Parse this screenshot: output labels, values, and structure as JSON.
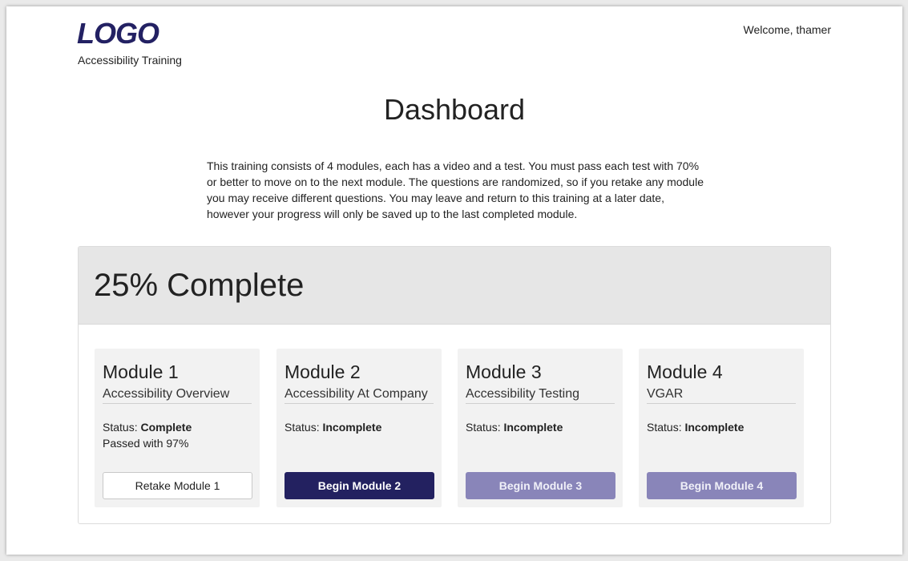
{
  "header": {
    "logo_text": "LOGO",
    "site_subtitle": "Accessibility Training",
    "welcome_text": "Welcome, thamer"
  },
  "main": {
    "title": "Dashboard",
    "intro": "This training consists of 4 modules, each has a video and a test. You must pass each test with 70% or better to move on to the next module. The questions are randomized, so if you retake any module you may receive different questions. You may leave and return to this training at a later date, however your progress will only be saved up to the last completed module."
  },
  "progress": {
    "label": "25% Complete",
    "percent": 25
  },
  "modules": [
    {
      "title": "Module 1",
      "subtitle": "Accessibility Overview",
      "status_label": "Status: ",
      "status_value": "Complete",
      "note": "Passed with 97%",
      "button_label": "Retake Module 1",
      "button_state": "outline"
    },
    {
      "title": "Module 2",
      "subtitle": "Accessibility At Company",
      "status_label": "Status: ",
      "status_value": "Incomplete",
      "note": "",
      "button_label": "Begin Module 2",
      "button_state": "active"
    },
    {
      "title": "Module 3",
      "subtitle": "Accessibility Testing",
      "status_label": "Status: ",
      "status_value": "Incomplete",
      "note": "",
      "button_label": "Begin Module 3",
      "button_state": "disabled"
    },
    {
      "title": "Module 4",
      "subtitle": "VGAR",
      "status_label": "Status: ",
      "status_value": "Incomplete",
      "note": "",
      "button_label": "Begin Module 4",
      "button_state": "disabled"
    }
  ],
  "colors": {
    "brand": "#232163",
    "primary_button": "#232160",
    "disabled_button": "#8985b9",
    "panel_header": "#e6e6e6",
    "card_background": "#f2f2f2"
  }
}
